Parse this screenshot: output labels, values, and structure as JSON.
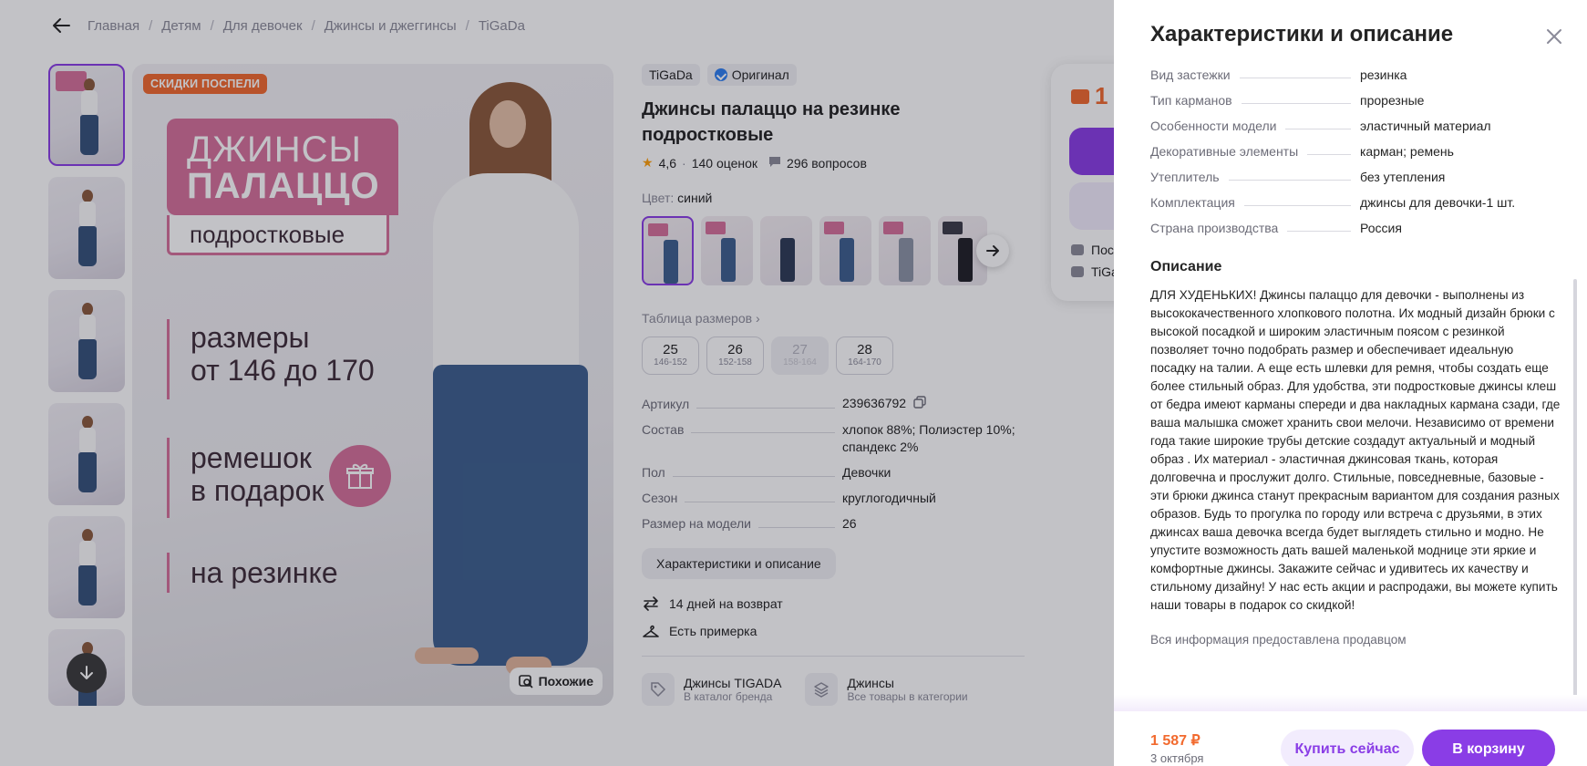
{
  "breadcrumbs": [
    "Главная",
    "Детям",
    "Для девочек",
    "Джинсы и джеггинсы",
    "TiGaDa"
  ],
  "hero": {
    "badge": "СКИДКИ ПОСПЕЛИ",
    "title_line1": "ДЖИНСЫ",
    "title_line2": "ПАЛАЦЦО",
    "subtitle": "подростковые",
    "feature1_line1": "размеры",
    "feature1_line2": "от 146 до 170",
    "feature2_line1": "ремешок",
    "feature2_line2": "в подарок",
    "feature3": "на резинке",
    "similar_label": "Похожие"
  },
  "product": {
    "brand": "TiGaDa",
    "original": "Оригинал",
    "title": "Джинсы палаццо на резинке подростковые",
    "rating": "4,6",
    "reviews": "140 оценок",
    "questions": "296 вопросов",
    "color_label": "Цвет:",
    "color_value": "синий",
    "size_table": "Таблица размеров",
    "sizes": [
      {
        "n": "25",
        "r": "146-152"
      },
      {
        "n": "26",
        "r": "152-158"
      },
      {
        "n": "27",
        "r": "158-164"
      },
      {
        "n": "28",
        "r": "164-170"
      }
    ],
    "specs": [
      {
        "k": "Артикул",
        "v": "239636792"
      },
      {
        "k": "Состав",
        "v": "хлопок 88%; Полиэстер 10%; спандекс 2%"
      },
      {
        "k": "Пол",
        "v": "Девочки"
      },
      {
        "k": "Сезон",
        "v": "круглогодичный"
      },
      {
        "k": "Размер на модели",
        "v": "26"
      }
    ],
    "desc_button": "Характеристики и описание",
    "perk_return": "14 дней на возврат",
    "perk_fitting": "Есть примерка",
    "link1_title": "Джинсы TIGADA",
    "link1_sub": "В каталог бренда",
    "link2_title": "Джинсы",
    "link2_sub": "Все товары в категории"
  },
  "buy_card": {
    "price_partial": "1",
    "row1": "Посл",
    "row2": "TiGa"
  },
  "drawer": {
    "title": "Характеристики и описание",
    "rows": [
      {
        "k": "Вид застежки",
        "v": "резинка"
      },
      {
        "k": "Тип карманов",
        "v": "прорезные"
      },
      {
        "k": "Особенности модели",
        "v": "эластичный материал"
      },
      {
        "k": "Декоративные элементы",
        "v": "карман; ремень"
      },
      {
        "k": "Утеплитель",
        "v": "без утепления"
      },
      {
        "k": "Комплектация",
        "v": "джинсы для девочки-1 шт."
      },
      {
        "k": "Страна производства",
        "v": "Россия"
      }
    ],
    "desc_title": "Описание",
    "description": "ДЛЯ ХУДЕНЬКИХ! Джинсы палаццо для девочки - выполнены из высококачественного хлопкового полотна. Их модный дизайн брюки с высокой посадкой и широким эластичным поясом с резинкой позволяет точно подобрать размер и обеспечивает идеальную посадку на талии. А еще есть шлевки для ремня, чтобы создать еще более стильный образ. Для удобства, эти подростковые джинсы клеш от бедра имеют карманы спереди и два накладных кармана сзади, где ваша малышка сможет хранить свои мелочи. Независимо от времени года такие широкие трубы детские создадут актуальный и модный образ . Их материал - эластичная джинсовая ткань, которая долговечна и прослужит долго. Стильные, повседневные, базовые - эти брюки джинса станут прекрасным вариантом для создания разных образов. Будь то прогулка по городу или встреча с друзьями, в этих джинсах ваша девочка всегда будет выглядеть стильно и модно. Не упустите возможность дать вашей маленькой моднице эти яркие и комфортные джинсы. Закажите сейчас и удивитесь их качеству и стильному дизайну! У нас есть акции и распродажи, вы можете купить наши товары в подарок со скидкой!",
    "note": "Вся информация предоставлена продавцом",
    "price": "1 587 ₽",
    "delivery": "3 октября",
    "buy_now": "Купить сейчас",
    "add_to_cart": "В корзину"
  },
  "colors": {
    "accent": "#8a3de6",
    "price": "#f26a2e",
    "pink": "#d6709a"
  }
}
